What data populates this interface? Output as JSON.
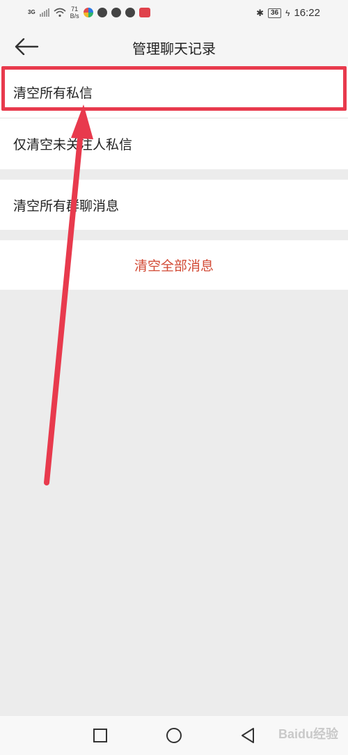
{
  "status_bar": {
    "network": "3G",
    "speed_value": "71",
    "speed_unit": "B/s",
    "battery": "36",
    "time": "16:22"
  },
  "header": {
    "title": "管理聊天记录",
    "back_icon": "arrow-left-icon"
  },
  "options": [
    {
      "label": "清空所有私信"
    },
    {
      "label": "仅清空未关注人私信"
    },
    {
      "label": "清空所有群聊消息"
    },
    {
      "label": "清空全部消息"
    }
  ],
  "nav_bar": {
    "icons": [
      "square-recents-icon",
      "circle-home-icon",
      "triangle-back-icon"
    ]
  },
  "colors": {
    "highlight": "#e83a4d",
    "danger_text": "#d24a35",
    "background": "#ececec"
  },
  "watermark": "Baidu经验"
}
